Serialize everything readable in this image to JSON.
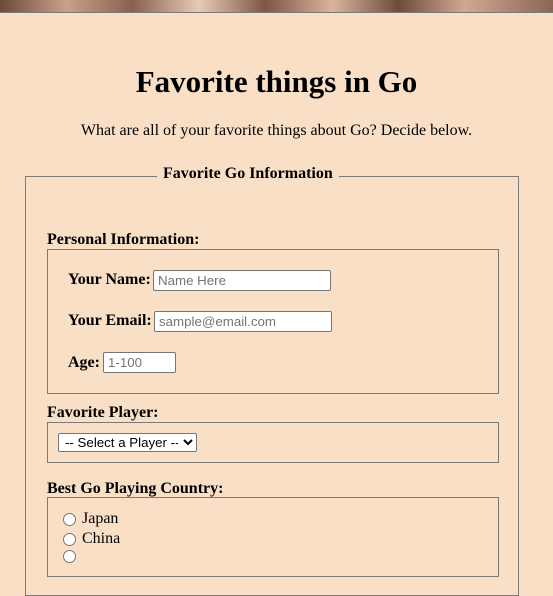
{
  "page": {
    "title": "Favorite things in Go",
    "intro": "What are all of your favorite things about Go? Decide below."
  },
  "form": {
    "legend": "Favorite Go Information",
    "personal": {
      "heading": "Personal Information:",
      "name_label": "Your Name:",
      "name_placeholder": "Name Here",
      "email_label": "Your Email:",
      "email_placeholder": "sample@email.com",
      "age_label": "Age:",
      "age_placeholder": "1-100"
    },
    "player": {
      "heading": "Favorite Player:",
      "selected": "-- Select a Player --"
    },
    "country": {
      "heading": "Best Go Playing Country:",
      "options": [
        "Japan",
        "China"
      ]
    }
  }
}
